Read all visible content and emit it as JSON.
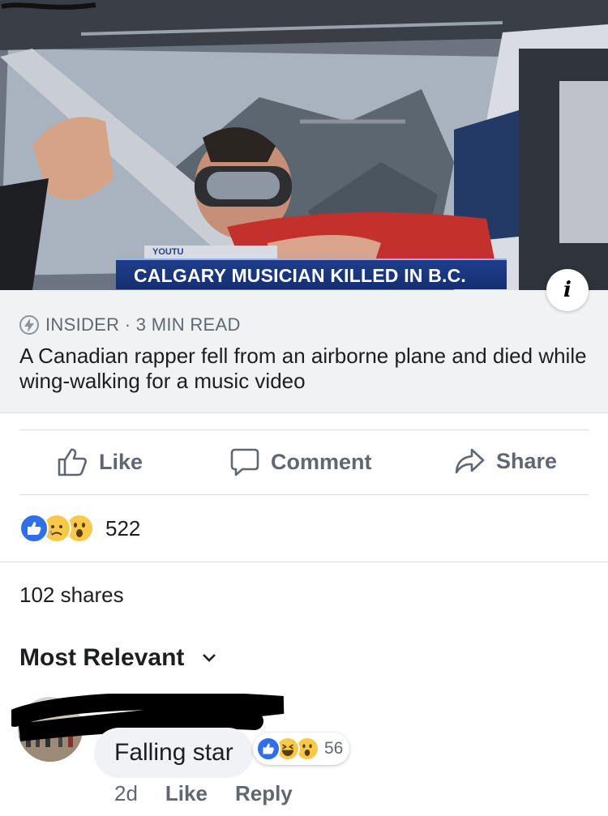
{
  "hero": {
    "caption": "CALGARY MUSICIAN KILLED IN B.C.",
    "caption_tag": "YOUTU",
    "info_glyph": "i"
  },
  "link": {
    "source": "INSIDER · 3 MIN READ",
    "headline": "A Canadian rapper fell from an airborne plane and died while wing-walking for a music video"
  },
  "actions": {
    "like": "Like",
    "comment": "Comment",
    "share": "Share"
  },
  "reactions": {
    "count": "522",
    "icons": [
      "like-icon",
      "sad-icon",
      "wow-icon"
    ]
  },
  "shares": "102 shares",
  "sort": {
    "label": "Most Relevant"
  },
  "comment": {
    "text": "Falling star",
    "reaction_count": "56",
    "reaction_icons": [
      "like-icon",
      "haha-icon",
      "wow-icon"
    ],
    "age": "2d",
    "like": "Like",
    "reply": "Reply"
  },
  "colors": {
    "facebook_blue": "#2f6fe8",
    "caption_bg": "#1f3d8a",
    "text_secondary": "#606770"
  }
}
